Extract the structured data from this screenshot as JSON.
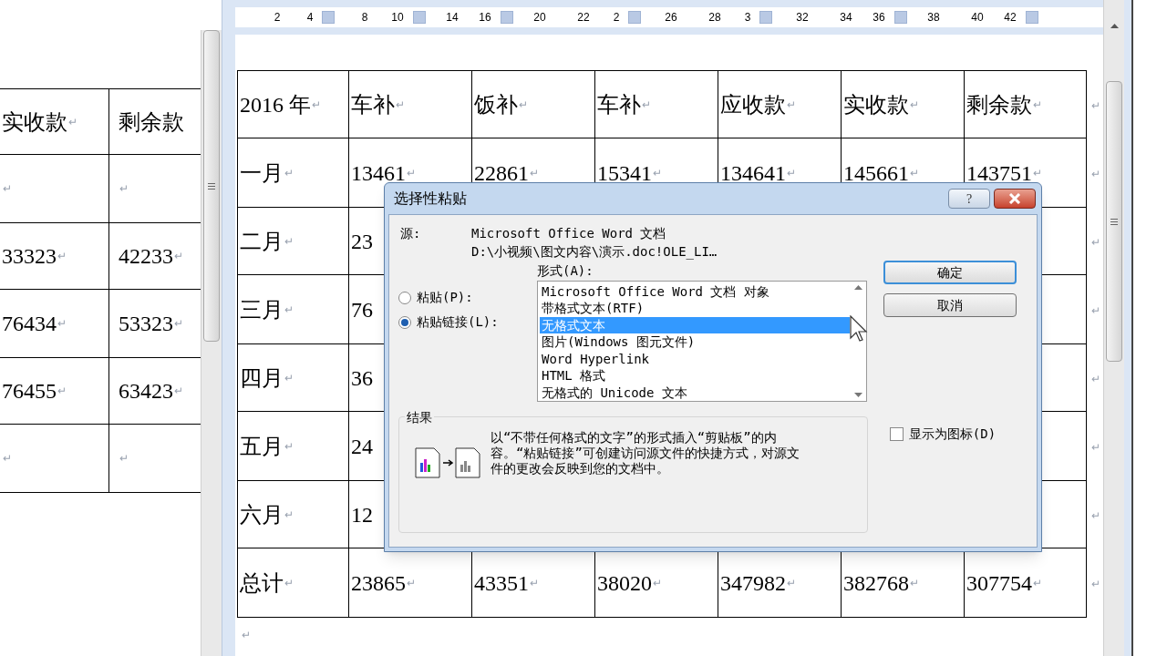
{
  "ruler": [
    {
      "label": "2",
      "marker": false
    },
    {
      "label": "4",
      "marker": true
    },
    {
      "label": "8",
      "marker": false
    },
    {
      "label": "10",
      "marker": true
    },
    {
      "label": "14",
      "marker": false
    },
    {
      "label": "16",
      "marker": true
    },
    {
      "label": "20",
      "marker": false
    },
    {
      "label": "22",
      "marker": false
    },
    {
      "label": "2",
      "marker": true
    },
    {
      "label": "26",
      "marker": false
    },
    {
      "label": "28",
      "marker": false
    },
    {
      "label": "3",
      "marker": true
    },
    {
      "label": "32",
      "marker": false
    },
    {
      "label": "34",
      "marker": false
    },
    {
      "label": "36",
      "marker": true
    },
    {
      "label": "38",
      "marker": false
    },
    {
      "label": "40",
      "marker": false
    },
    {
      "label": "42",
      "marker": true
    }
  ],
  "left_table": {
    "rows": [
      [
        {
          "text": "实收款",
          "mark": "↵"
        },
        {
          "text": "剩余款"
        }
      ],
      [
        {
          "mark": "↵"
        },
        {
          "mark": "↵"
        }
      ],
      [
        {
          "text": "33323",
          "mark": "↵"
        },
        {
          "text": "42233",
          "mark": "↵"
        }
      ],
      [
        {
          "text": "76434",
          "mark": "↵"
        },
        {
          "text": "53323",
          "mark": "↵"
        }
      ],
      [
        {
          "text": "76455",
          "mark": "↵"
        },
        {
          "text": "63423",
          "mark": "↵"
        }
      ],
      [
        {
          "mark": "↵"
        },
        {
          "mark": "↵"
        }
      ]
    ]
  },
  "table": {
    "rows": [
      {
        "cells": [
          {
            "text": "2016 年",
            "mark": "↵"
          },
          {
            "text": "车补",
            "mark": "↵"
          },
          {
            "text": "饭补",
            "mark": "↵"
          },
          {
            "text": "车补",
            "mark": "↵"
          },
          {
            "text": "应收款",
            "mark": "↵"
          },
          {
            "text": "实收款",
            "mark": "↵"
          },
          {
            "text": "剩余款",
            "mark": "↵"
          }
        ],
        "end_mark": "↵"
      },
      {
        "cells": [
          {
            "text": "一月",
            "mark": "↵"
          },
          {
            "text": "13461",
            "mark": "↵"
          },
          {
            "text": "22861",
            "mark": "↵"
          },
          {
            "text": "15341",
            "mark": "↵"
          },
          {
            "text": "134641",
            "mark": "↵"
          },
          {
            "text": "145661",
            "mark": "↵"
          },
          {
            "text": "143751",
            "mark": "↵"
          }
        ],
        "end_mark": "↵"
      },
      {
        "cells": [
          {
            "text": "二月",
            "mark": "↵"
          },
          {
            "text": "23"
          }
        ],
        "end_mark": "↵"
      },
      {
        "cells": [
          {
            "text": "三月",
            "mark": "↵"
          },
          {
            "text": "76"
          }
        ],
        "end_mark": "↵"
      },
      {
        "cells": [
          {
            "text": "四月",
            "mark": "↵"
          },
          {
            "text": "36"
          }
        ],
        "end_mark": "↵"
      },
      {
        "cells": [
          {
            "text": "五月",
            "mark": "↵"
          },
          {
            "text": "24"
          }
        ],
        "end_mark": "↵"
      },
      {
        "cells": [
          {
            "text": "六月",
            "mark": "↵"
          },
          {
            "text": "12"
          }
        ],
        "end_mark": "↵"
      },
      {
        "cells": [
          {
            "text": "总计",
            "mark": "↵"
          },
          {
            "text": "23865",
            "mark": "↵"
          },
          {
            "text": "43351",
            "mark": "↵"
          },
          {
            "text": "38020",
            "mark": "↵"
          },
          {
            "text": "347982",
            "mark": "↵"
          },
          {
            "text": "382768",
            "mark": "↵"
          },
          {
            "text": "307754",
            "mark": "↵"
          }
        ],
        "end_mark": "↵"
      }
    ],
    "after_mark": "↵"
  },
  "dialog": {
    "title": "选择性粘贴",
    "help": "?",
    "source_label": "源:",
    "source_lines": [
      "Microsoft Office Word 文档",
      "D:\\小视频\\图文内容\\演示.doc!OLE_LI…"
    ],
    "format_label": "形式(A):",
    "radios": [
      {
        "label": "粘贴(P):",
        "selected": false
      },
      {
        "label": "粘贴链接(L):",
        "selected": true
      }
    ],
    "formats": [
      {
        "label": "Microsoft Office Word 文档 对象",
        "selected": false
      },
      {
        "label": "带格式文本(RTF)",
        "selected": false
      },
      {
        "label": "无格式文本",
        "selected": true
      },
      {
        "label": "图片(Windows 图元文件)",
        "selected": false
      },
      {
        "label": "Word Hyperlink",
        "selected": false
      },
      {
        "label": "HTML 格式",
        "selected": false
      },
      {
        "label": "无格式的 Unicode 文本",
        "selected": false
      }
    ],
    "buttons": [
      {
        "label": "确定",
        "default": true
      },
      {
        "label": "取消",
        "default": false
      }
    ],
    "display_as_icon": {
      "label": "显示为图标(D)",
      "checked": false
    },
    "result": {
      "title": "结果",
      "text": "以“不带任何格式的文字”的形式插入“剪贴板”的内容。“粘贴链接”可创建访问源文件的快捷方式，对源文件的更改会反映到您的文档中。"
    }
  }
}
